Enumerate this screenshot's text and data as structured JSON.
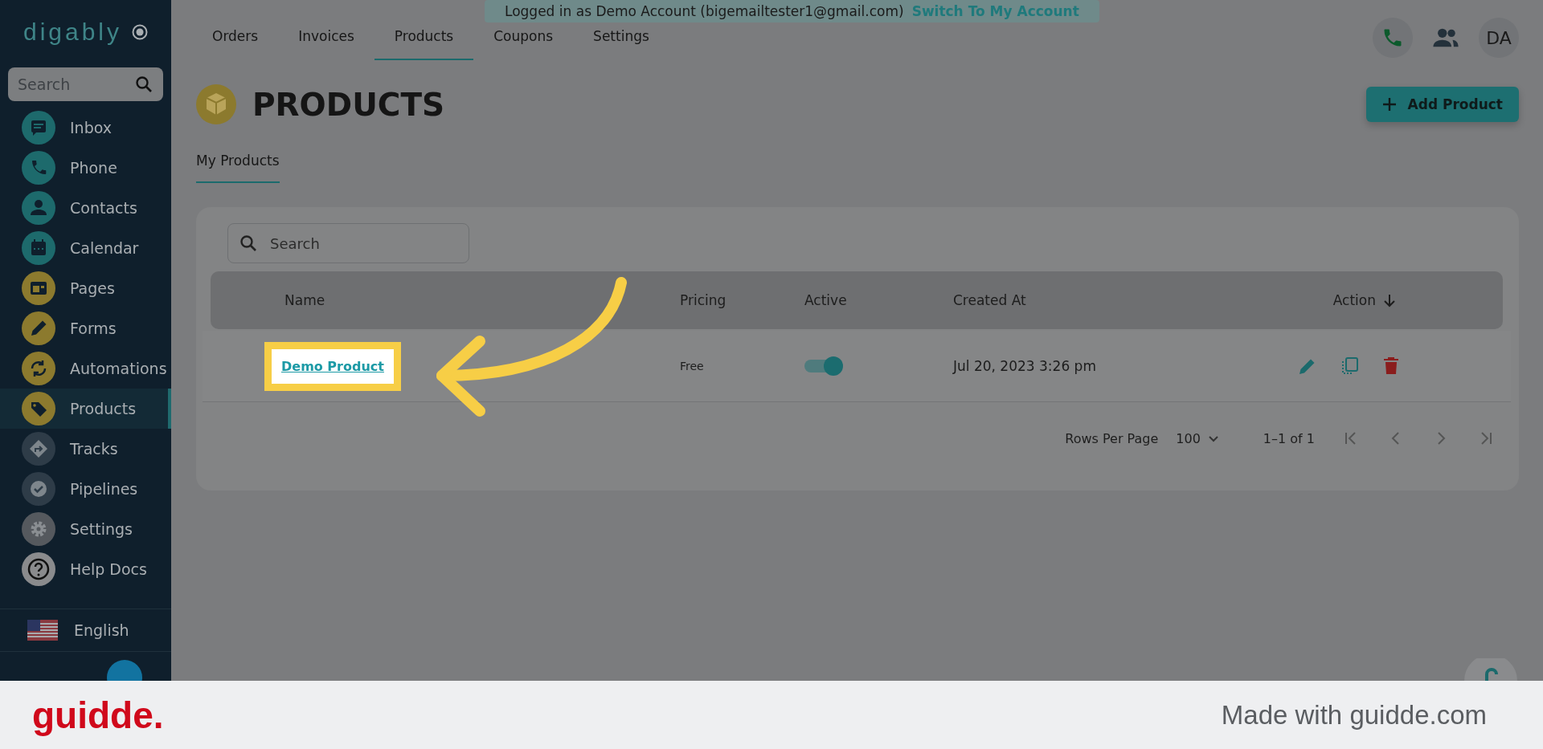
{
  "sidebar": {
    "logo": "digably",
    "search": {
      "placeholder": "Search"
    },
    "items": [
      {
        "label": "Inbox",
        "color": "#1d6a6c",
        "selected": false
      },
      {
        "label": "Phone",
        "color": "#1d6a6c",
        "selected": false
      },
      {
        "label": "Contacts",
        "color": "#1d6a6c",
        "selected": false
      },
      {
        "label": "Calendar",
        "color": "#1d6a6c",
        "selected": false
      },
      {
        "label": "Pages",
        "color": "#8c7a2e",
        "selected": false
      },
      {
        "label": "Forms",
        "color": "#8c7a2e",
        "selected": false
      },
      {
        "label": "Automations",
        "color": "#8c7a2e",
        "selected": false
      },
      {
        "label": "Products",
        "color": "#8c7a2e",
        "selected": true
      },
      {
        "label": "Tracks",
        "color": "#2e3c48",
        "selected": false
      },
      {
        "label": "Pipelines",
        "color": "#2e3c48",
        "selected": false
      },
      {
        "label": "Settings",
        "color": "#55595e",
        "selected": false
      },
      {
        "label": "Help Docs",
        "color": "#8a8b8d",
        "selected": false
      }
    ],
    "language": "English"
  },
  "banner": {
    "text": "Logged in as Demo Account (bigemailtester1@gmail.com)",
    "link": "Switch To My Account"
  },
  "nav": {
    "tabs": [
      {
        "label": "Orders",
        "selected": false
      },
      {
        "label": "Invoices",
        "selected": false
      },
      {
        "label": "Products",
        "selected": true
      },
      {
        "label": "Coupons",
        "selected": false
      },
      {
        "label": "Settings",
        "selected": false
      }
    ],
    "avatar": "DA"
  },
  "page": {
    "title": "PRODUCTS",
    "add_button": "Add Product",
    "tabs": [
      {
        "label": "My Products",
        "selected": true
      }
    ]
  },
  "table": {
    "search": {
      "placeholder": "Search"
    },
    "columns": [
      "Name",
      "Pricing",
      "Active",
      "Created At",
      "Action"
    ],
    "rows": [
      {
        "name": "Demo Product",
        "pricing": "Free",
        "active": true,
        "created_at": "Jul 20, 2023 3:26 pm"
      }
    ]
  },
  "pagination": {
    "rows_per_page_label": "Rows Per Page",
    "rows_per_page": "100",
    "range": "1–1 of 1"
  },
  "footer": {
    "brand": "guidde.",
    "text": "Made with guidde.com"
  }
}
